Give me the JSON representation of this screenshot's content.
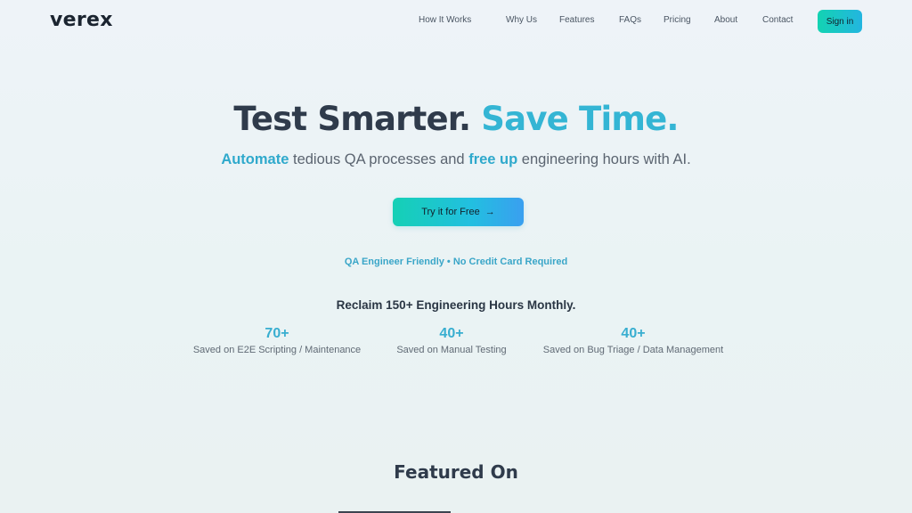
{
  "header": {
    "logo": "verex",
    "nav": [
      {
        "label": "How It Works"
      },
      {
        "label": "Why Us"
      },
      {
        "label": "Features"
      },
      {
        "label": "FAQs"
      },
      {
        "label": "Pricing"
      },
      {
        "label": "About"
      },
      {
        "label": "Contact"
      }
    ],
    "signin_label": "Sign in"
  },
  "hero": {
    "title_part1": "Test Smarter.",
    "title_part2": "Save Time.",
    "subtitle": {
      "w1": "Automate",
      "t1": " tedious QA processes and ",
      "w2": "free up",
      "t2": " engineering hours with AI."
    },
    "cta_label": "Try it for Free",
    "cta_icon": "arrow-right-icon",
    "friendly_note": "QA Engineer Friendly • No Credit Card Required"
  },
  "stats": {
    "heading": "Reclaim 150+ Engineering Hours Monthly.",
    "items": [
      {
        "value": "70+",
        "label": "Saved on E2E Scripting / Maintenance"
      },
      {
        "value": "40+",
        "label": "Saved on Manual Testing"
      },
      {
        "value": "40+",
        "label": "Saved on Bug Triage / Data Management"
      }
    ]
  },
  "featured": {
    "heading": "Featured On"
  },
  "colors": {
    "accent": "#34b5d4",
    "button_gradient_start": "#15d0b5",
    "button_gradient_end": "#3a9ff0",
    "text_dark": "#2f3b4b"
  }
}
